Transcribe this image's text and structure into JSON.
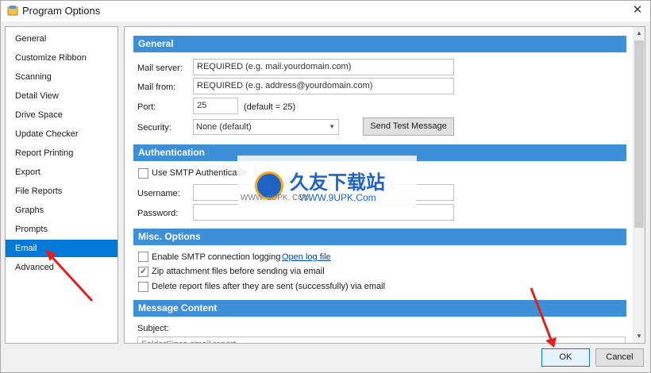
{
  "window": {
    "title": "Program Options",
    "close_symbol": "✕"
  },
  "sidebar": {
    "items": [
      {
        "label": "General"
      },
      {
        "label": "Customize Ribbon"
      },
      {
        "label": "Scanning"
      },
      {
        "label": "Detail View"
      },
      {
        "label": "Drive Space"
      },
      {
        "label": "Update Checker"
      },
      {
        "label": "Report Printing"
      },
      {
        "label": "Export"
      },
      {
        "label": "File Reports"
      },
      {
        "label": "Graphs"
      },
      {
        "label": "Prompts"
      },
      {
        "label": "Email"
      },
      {
        "label": "Advanced"
      }
    ],
    "selected": "Email"
  },
  "general": {
    "header": "General",
    "mail_server_label": "Mail server:",
    "mail_server_value": "REQUIRED (e.g. mail.yourdomain.com)",
    "mail_from_label": "Mail from:",
    "mail_from_value": "REQUIRED (e.g. address@yourdomain.com)",
    "port_label": "Port:",
    "port_value": "25",
    "port_default": "(default = 25)",
    "security_label": "Security:",
    "security_value": "None (default)",
    "send_test_label": "Send Test Message"
  },
  "authentication": {
    "header": "Authentication",
    "use_smtp_label": "Use SMTP Authenticatio",
    "use_smtp_checked": false,
    "username_label": "Username:",
    "password_label": "Password:"
  },
  "misc": {
    "header": "Misc. Options",
    "enable_logging_label": "Enable SMTP connection logging",
    "enable_logging_checked": false,
    "open_log_label": "Open log file",
    "zip_label": "Zip attachment files before sending via email",
    "zip_checked": true,
    "delete_label": "Delete report files after they are sent (successfully) via email",
    "delete_checked": false
  },
  "message": {
    "header": "Message Content",
    "subject_label": "Subject:",
    "subject_value": "FolderSizes email report"
  },
  "watermark": {
    "brand": "久友下载站",
    "site": "WWW.9UPK.Com",
    "left_text": "WWW. 9UPK. COM"
  },
  "footer": {
    "ok_label": "OK",
    "cancel_label": "Cancel"
  },
  "colors": {
    "accent": "#0078d7",
    "section_header": "#3d8fd8",
    "arrow": "#e0201a"
  }
}
